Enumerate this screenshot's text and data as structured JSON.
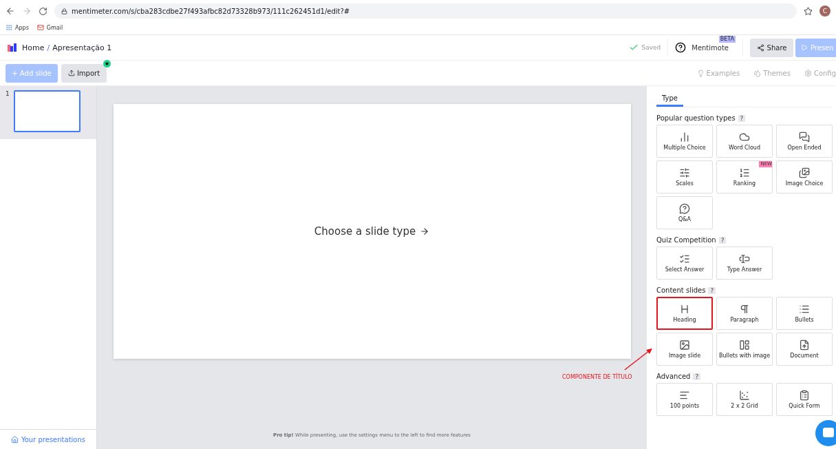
{
  "browser": {
    "url": "mentimeter.com/s/cba283cdbe27f493afbc82d73328b973/111c262451d1/edit?#",
    "avatar": "C",
    "bookmarks": [
      {
        "label": "Apps"
      },
      {
        "label": "Gmail"
      }
    ]
  },
  "header": {
    "home": "Home",
    "separator": "/",
    "title": "Apresentação 1",
    "saved": "Saved",
    "mentimote": "Mentimote",
    "beta": "BETA",
    "share": "Share",
    "present": "Presen"
  },
  "toolbar": {
    "add_slide": "+ Add slide",
    "import": "Import",
    "links": [
      {
        "label": "Examples"
      },
      {
        "label": "Themes"
      },
      {
        "label": "Config"
      }
    ]
  },
  "slides": [
    {
      "number": "1",
      "selected": true
    }
  ],
  "sidebar_footer": "Your presentations",
  "canvas": {
    "prompt": "Choose a slide type",
    "tip_bold": "Pro tip!",
    "tip": "While presenting, use the settings menu to the left to find more features"
  },
  "panel": {
    "tabs": [
      {
        "label": "Type",
        "selected": true
      }
    ],
    "sections": [
      {
        "title": "Popular question types",
        "help": "?",
        "items": [
          {
            "label": "Multiple Choice",
            "highlighted": false
          },
          {
            "label": "Word Cloud",
            "highlighted": false
          },
          {
            "label": "Open Ended",
            "highlighted": false
          },
          {
            "label": "Scales",
            "highlighted": false
          },
          {
            "label": "Ranking",
            "badge": "NEW",
            "highlighted": false
          },
          {
            "label": "Image Choice",
            "highlighted": false
          },
          {
            "label": "Q&A",
            "highlighted": false
          }
        ]
      },
      {
        "title": "Quiz Competition",
        "help": "?",
        "items": [
          {
            "label": "Select Answer",
            "highlighted": false
          },
          {
            "label": "Type Answer",
            "highlighted": false
          }
        ]
      },
      {
        "title": "Content slides",
        "help": "?",
        "items": [
          {
            "label": "Heading",
            "highlighted": true
          },
          {
            "label": "Paragraph",
            "highlighted": false
          },
          {
            "label": "Bullets",
            "highlighted": false
          },
          {
            "label": "Image slide",
            "highlighted": false
          },
          {
            "label": "Bullets with image",
            "highlighted": false
          },
          {
            "label": "Document",
            "highlighted": false
          }
        ]
      },
      {
        "title": "Advanced",
        "help": "?",
        "items": [
          {
            "label": "100 points",
            "highlighted": false
          },
          {
            "label": "2 x 2 Grid",
            "highlighted": false
          },
          {
            "label": "Quick Form",
            "highlighted": false
          }
        ]
      }
    ]
  },
  "annotation": {
    "text": "COMPONENTE DE TÍTULO"
  }
}
